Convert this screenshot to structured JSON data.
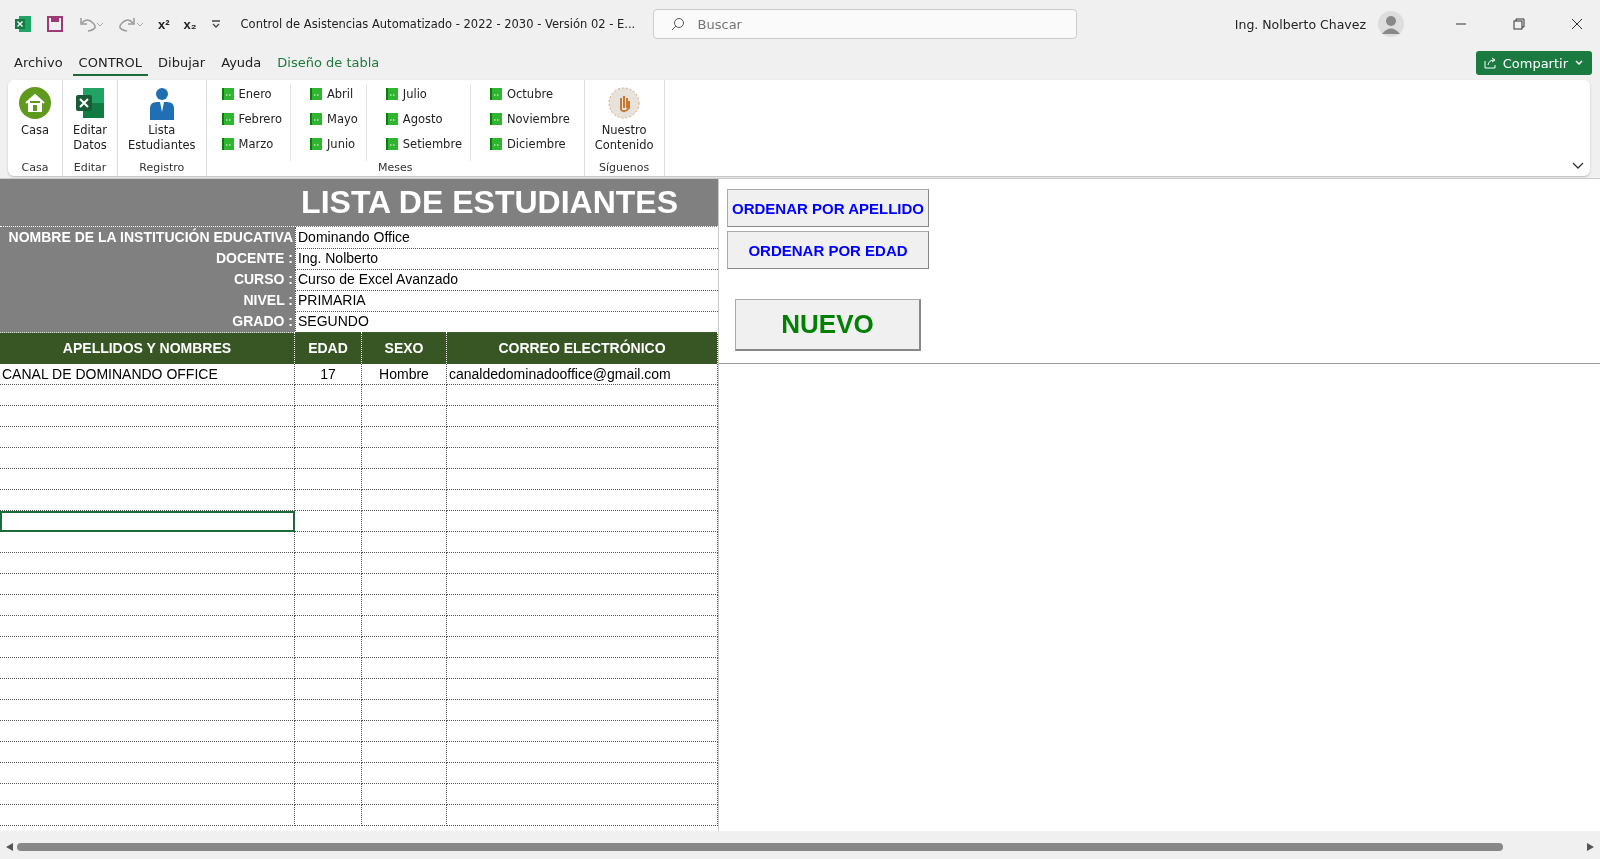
{
  "window": {
    "title": "Control de Asistencias Automatizado - 2022 - 2030 - Versión 02  -  E...",
    "search_placeholder": "Buscar",
    "user": "Ing. Nolberto Chavez"
  },
  "quick_access": {
    "superscript": "x²",
    "subscript": "x₂"
  },
  "menu_tabs": [
    {
      "label": "Archivo",
      "selected": false,
      "kind": "normal"
    },
    {
      "label": "CONTROL",
      "selected": true,
      "kind": "normal"
    },
    {
      "label": "Dibujar",
      "selected": false,
      "kind": "normal"
    },
    {
      "label": "Ayuda",
      "selected": false,
      "kind": "normal"
    },
    {
      "label": "Diseño de tabla",
      "selected": false,
      "kind": "contextual"
    }
  ],
  "share_button": "Compartir",
  "ribbon": {
    "groups": [
      {
        "name": "Casa",
        "kind": "large",
        "items": [
          {
            "label": "Casa"
          }
        ]
      },
      {
        "name": "Editar",
        "kind": "large",
        "items": [
          {
            "label": "Editar Datos"
          }
        ]
      },
      {
        "name": "Registro",
        "kind": "large",
        "items": [
          {
            "label": "Lista Estudiantes"
          }
        ]
      },
      {
        "name": "Meses",
        "kind": "months",
        "columns": [
          [
            "Enero",
            "Febrero",
            "Marzo"
          ],
          [
            "Abril",
            "Mayo",
            "Junio"
          ],
          [
            "Julio",
            "Agosto",
            "Setiembre"
          ],
          [
            "Octubre",
            "Noviembre",
            "Diciembre"
          ]
        ]
      },
      {
        "name": "Síguenos",
        "kind": "large",
        "items": [
          {
            "label": "Nuestro Contenido"
          }
        ]
      }
    ]
  },
  "sheet": {
    "title": "LISTA DE ESTUDIANTES",
    "info": [
      {
        "label": "NOMBRE DE LA INSTITUCIÓN EDUCATIVA",
        "value": "Dominando Office"
      },
      {
        "label": "DOCENTE :",
        "value": "Ing. Nolberto"
      },
      {
        "label": "CURSO :",
        "value": "Curso de Excel Avanzado"
      },
      {
        "label": "NIVEL :",
        "value": "PRIMARIA"
      },
      {
        "label": "GRADO :",
        "value": "SEGUNDO"
      }
    ],
    "columns": [
      "APELLIDOS Y NOMBRES",
      "EDAD",
      "SEXO",
      "CORREO ELECTRÓNICO"
    ],
    "rows": [
      {
        "cells": [
          "CANAL DE DOMINANDO OFFICE",
          "17",
          "Hombre",
          "canaldedominadooffice@gmail.com"
        ],
        "selected": false
      },
      {
        "selected": false
      },
      {
        "selected": false
      },
      {
        "selected": false
      },
      {
        "selected": false
      },
      {
        "selected": false
      },
      {
        "selected": false
      },
      {
        "selected": true
      },
      {
        "selected": false
      },
      {
        "selected": false
      },
      {
        "selected": false
      },
      {
        "selected": false
      },
      {
        "selected": false
      },
      {
        "selected": false
      },
      {
        "selected": false
      },
      {
        "selected": false
      },
      {
        "selected": false
      },
      {
        "selected": false
      },
      {
        "selected": false
      },
      {
        "selected": false
      },
      {
        "selected": false
      },
      {
        "selected": false
      }
    ],
    "buttons": [
      {
        "label": "ORDENAR POR APELLIDO",
        "kind": "sort"
      },
      {
        "label": "ORDENAR POR EDAD",
        "kind": "sort"
      },
      {
        "label": "NUEVO",
        "kind": "new"
      }
    ]
  }
}
